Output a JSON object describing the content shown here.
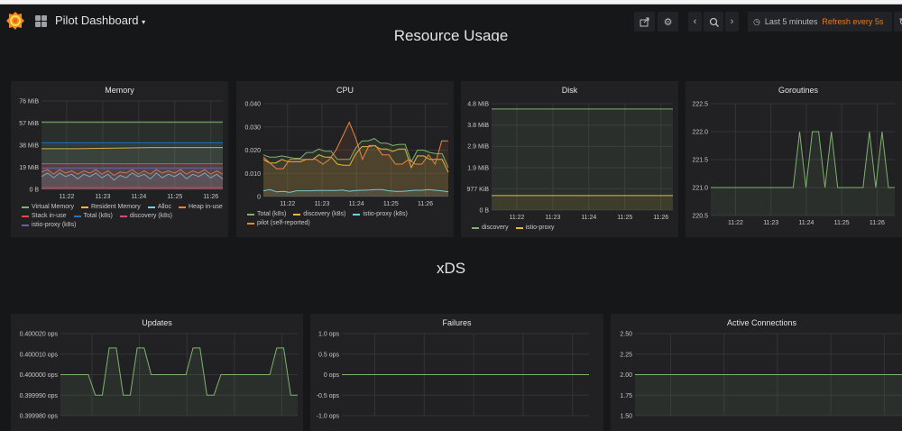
{
  "nav": {
    "title": "Pilot Dashboard",
    "caret": "▾",
    "time_range": "Last 5 minutes",
    "refresh": "Refresh every 5s",
    "icons": [
      "share-icon",
      "gear-icon",
      "chevron-left-icon",
      "zoom-out-icon",
      "chevron-right-icon",
      "clock-icon",
      "refresh-icon"
    ]
  },
  "rows": {
    "resource": "Resource Usage",
    "xds": "xDS"
  },
  "colors": {
    "green": "#7eb26d",
    "yellow": "#eab839",
    "cyan": "#6ed0e0",
    "orange": "#ef843c",
    "red": "#e24d42",
    "blue": "#1f78c1",
    "pink": "#ba43a9",
    "magenta": "#e5457a",
    "purple": "#705da0",
    "accent": "#eb7b18"
  },
  "panels": [
    {
      "title": "Memory",
      "chart_data": {
        "type": "line",
        "x_range": [
          "11:21:18",
          "11:26:20"
        ],
        "x_ticks": [
          "11:22",
          "11:23",
          "11:24",
          "11:25",
          "11:26"
        ],
        "ylim": [
          0,
          76
        ],
        "y_ticks": [
          0,
          19,
          38,
          57,
          76
        ],
        "y_tick_labels": [
          "0 B",
          "19 MiB",
          "38 MiB",
          "57 MiB",
          "76 MiB"
        ],
        "unit": "MiB",
        "fill": true,
        "series": [
          {
            "name": "Virtual Memory",
            "color": "#7eb26d",
            "values": [
              58,
              58,
              58,
              58,
              58,
              58
            ]
          },
          {
            "name": "Resident Memory",
            "color": "#eab839",
            "values": [
              35,
              35,
              35.5,
              36,
              36,
              36
            ]
          },
          {
            "name": "Alloc",
            "color": "#6ed0e0",
            "values": [
              11,
              14,
              10,
              14,
              11,
              13,
              9,
              13,
              11,
              14,
              10,
              13,
              8,
              12,
              10,
              14,
              11,
              13,
              9,
              14,
              10,
              13,
              11,
              14,
              9,
              13,
              11,
              14,
              10,
              13,
              9
            ]
          },
          {
            "name": "Heap in-use",
            "color": "#ef843c",
            "values": [
              15,
              17,
              13,
              17,
              14,
              16,
              13,
              16,
              14,
              17,
              13,
              16,
              12,
              15,
              14,
              17,
              13,
              16,
              13,
              17,
              14,
              16,
              14,
              17,
              13,
              16,
              14,
              17,
              13,
              16,
              13
            ]
          },
          {
            "name": "Stack in-use",
            "color": "#e24d42",
            "values": [
              1.5,
              1.5,
              1.5,
              1.5,
              1.5,
              1.5
            ]
          },
          {
            "name": "Total (k8s)",
            "color": "#1f78c1",
            "values": [
              40,
              40,
              40,
              40,
              40,
              40
            ]
          },
          {
            "name": "discovery (k8s)",
            "color": "#e5457a",
            "values": [
              22,
              22,
              22,
              22,
              22,
              22
            ]
          },
          {
            "name": "istio-proxy (k8s)",
            "color": "#705da0",
            "values": [
              18,
              18,
              18,
              18,
              18,
              18
            ]
          }
        ]
      }
    },
    {
      "title": "CPU",
      "chart_data": {
        "type": "line",
        "x_range": [
          "11:21:18",
          "11:26:40"
        ],
        "x_ticks": [
          "11:22",
          "11:23",
          "11:24",
          "11:25",
          "11:26"
        ],
        "ylim": [
          0,
          0.04
        ],
        "y_ticks": [
          0,
          0.01,
          0.02,
          0.03,
          0.04
        ],
        "y_tick_labels": [
          "0",
          "0.010",
          "0.020",
          "0.030",
          "0.040"
        ],
        "fill": true,
        "series": [
          {
            "name": "Total (k8s)",
            "color": "#7eb26d",
            "values": [
              0.018,
              0.017,
              0.017,
              0.0175,
              0.017,
              0.0165,
              0.0165,
              0.019,
              0.019,
              0.0205,
              0.0195,
              0.0195,
              0.016,
              0.016,
              0.016,
              0.021,
              0.024,
              0.024,
              0.025,
              0.023,
              0.023,
              0.022,
              0.0225,
              0.0225,
              0.015,
              0.02,
              0.02,
              0.019,
              0.0185,
              0.0185,
              0.0125
            ]
          },
          {
            "name": "discovery (k8s)",
            "color": "#eab839",
            "values": [
              0.016,
              0.0145,
              0.0145,
              0.016,
              0.015,
              0.015,
              0.015,
              0.016,
              0.016,
              0.018,
              0.017,
              0.017,
              0.014,
              0.0135,
              0.0135,
              0.0185,
              0.0215,
              0.0215,
              0.022,
              0.0205,
              0.0205,
              0.0195,
              0.0205,
              0.0205,
              0.0125,
              0.0175,
              0.0175,
              0.016,
              0.016,
              0.016,
              0.0105
            ]
          },
          {
            "name": "istio-proxy (k8s)",
            "color": "#6ed0e0",
            "values": [
              0.0025,
              0.003,
              0.002,
              0.0022,
              0.0018,
              0.0025,
              0.0025,
              0.0025,
              0.0026,
              0.0026,
              0.0026,
              0.0026,
              0.0028,
              0.0023,
              0.0026,
              0.0027,
              0.0028,
              0.003,
              0.003,
              0.0025,
              0.0022,
              0.0022,
              0.0025,
              0.0027,
              0.0027,
              0.003,
              0.0027,
              0.0025,
              0.002
            ]
          },
          {
            "name": "pilot (self-reported)",
            "color": "#ef843c",
            "values": [
              0.017,
              0.0145,
              0.012,
              0.012,
              0.016,
              0.016,
              0.016,
              0.016,
              0.016,
              0.014,
              0.016,
              0.02,
              0.026,
              0.032,
              0.025,
              0.016,
              0.022,
              0.022,
              0.018,
              0.018,
              0.014,
              0.014,
              0.016,
              0.014,
              0.014,
              0.018,
              0.014,
              0.024,
              0.024
            ]
          }
        ]
      }
    },
    {
      "title": "Disk",
      "chart_data": {
        "type": "line",
        "x_range": [
          "11:21:18",
          "11:26:20"
        ],
        "x_ticks": [
          "11:22",
          "11:23",
          "11:24",
          "11:25",
          "11:26"
        ],
        "ylim": [
          0,
          4.77
        ],
        "y_ticks": [
          0,
          0.954,
          1.9,
          2.86,
          3.81,
          4.77
        ],
        "y_tick_labels": [
          "0 B",
          "977 KiB",
          "1.9 MiB",
          "2.9 MiB",
          "3.8 MiB",
          "4.8 MiB"
        ],
        "unit": "MiB",
        "fill": true,
        "series": [
          {
            "name": "discovery",
            "color": "#7eb26d",
            "values": [
              4.53,
              4.53
            ]
          },
          {
            "name": "istio-proxy",
            "color": "#eab839",
            "values": [
              0.65,
              0.65
            ]
          }
        ]
      }
    },
    {
      "title": "Goroutines",
      "chart_data": {
        "type": "line",
        "x_range": [
          "11:21:18",
          "11:26:30"
        ],
        "x_ticks": [
          "11:22",
          "11:23",
          "11:24",
          "11:25",
          "11:26"
        ],
        "ylim": [
          220.5,
          222.5
        ],
        "y_ticks": [
          220.5,
          221,
          221.5,
          222,
          222.5
        ],
        "y_tick_labels": [
          "220.5",
          "221.0",
          "221.5",
          "222.0",
          "222.5"
        ],
        "fill": true,
        "series": [
          {
            "name": "",
            "color": "#7eb26d",
            "values": [
              221,
              221,
              221,
              221,
              221,
              221,
              221,
              221,
              221,
              221,
              221,
              221,
              221,
              221,
              222,
              221,
              222,
              222,
              221,
              222,
              221,
              221,
              221,
              221,
              221,
              222,
              221,
              222,
              221,
              221
            ]
          }
        ]
      }
    },
    {
      "title": "Updates",
      "chart_data": {
        "type": "line",
        "x_range": [
          "11:21:20",
          "11:26:20"
        ],
        "ylim": [
          0.39998,
          0.40002
        ],
        "y_ticks": [
          0.39998,
          0.39999,
          0.4,
          0.40001,
          0.40002
        ],
        "y_tick_labels": [
          "0.399980 ops",
          "0.399990 ops",
          "0.400000 ops",
          "0.400010 ops",
          "0.400020 ops"
        ],
        "fill": true,
        "series": [
          {
            "name": "",
            "color": "#7eb26d",
            "values": [
              0.4,
              0.4,
              0.4,
              0.4,
              0.4,
              0.39999,
              0.39999,
              0.400013,
              0.400013,
              0.39999,
              0.39999,
              0.400013,
              0.400013,
              0.4,
              0.4,
              0.4,
              0.4,
              0.4,
              0.4,
              0.400013,
              0.400013,
              0.39999,
              0.39999,
              0.4,
              0.4,
              0.4,
              0.4,
              0.4,
              0.4,
              0.4,
              0.4,
              0.400013,
              0.400013,
              0.39999,
              0.39999
            ]
          }
        ]
      }
    },
    {
      "title": "Failures",
      "chart_data": {
        "type": "line",
        "x_range": [
          "11:21:20",
          "11:26:20"
        ],
        "ylim": [
          -1,
          1
        ],
        "y_ticks": [
          -1,
          -0.5,
          0,
          0.5,
          1
        ],
        "y_tick_labels": [
          "-1.0 ops",
          "-0.5 ops",
          "0 ops",
          "0.5 ops",
          "1.0 ops"
        ],
        "fill": false,
        "series": [
          {
            "name": "",
            "color": "#7eb26d",
            "values": [
              0,
              0
            ]
          }
        ]
      }
    },
    {
      "title": "Active Connections",
      "chart_data": {
        "type": "line",
        "x_range": [
          "11:21:20",
          "11:26:20"
        ],
        "ylim": [
          1.5,
          2.5
        ],
        "y_ticks": [
          1.5,
          1.75,
          2,
          2.25,
          2.5
        ],
        "y_tick_labels": [
          "1.50",
          "1.75",
          "2.00",
          "2.25",
          "2.50"
        ],
        "fill": true,
        "series": [
          {
            "name": "",
            "color": "#7eb26d",
            "values": [
              2,
              2
            ]
          }
        ]
      }
    }
  ]
}
